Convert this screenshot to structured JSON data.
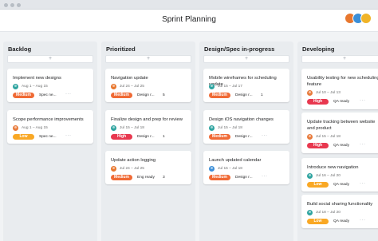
{
  "app": {
    "title": "Sprint Planning",
    "avatars": [
      "#e8772e",
      "#3c8fd8",
      "#f0b429"
    ]
  },
  "priority_colors": {
    "Medium": "#f06a35",
    "Low": "#f9a825",
    "High": "#e8384f"
  },
  "add_label": "+",
  "columns": [
    {
      "title": "Backlog",
      "cards": [
        {
          "title": "Implement new designs",
          "date": "Aug 1 – Aug 15",
          "priority": "Medium",
          "status": "Spec ne...",
          "count": "",
          "avatar": "#2fa4a0"
        },
        {
          "title": "Scope performance improvements",
          "date": "Aug 1 – Aug 15",
          "priority": "Low",
          "status": "Spec ne...",
          "count": "",
          "avatar": "#e87b3c"
        }
      ]
    },
    {
      "title": "Prioritized",
      "cards": [
        {
          "title": "Navigation update",
          "date": "Jul 24 – Jul 25",
          "priority": "Medium",
          "status": "Design r...",
          "count": "5",
          "avatar": "#e8772e"
        },
        {
          "title": "Finalize design and prep for review",
          "date": "Jul 15 – Jul 18",
          "priority": "High",
          "status": "Design r...",
          "count": "1",
          "avatar": "#2fa4a0"
        },
        {
          "title": "Update action logging",
          "date": "Jul 24 – Jul 25",
          "priority": "Medium",
          "status": "Eng ready",
          "count": "3",
          "avatar": "#e8772e"
        }
      ]
    },
    {
      "title": "Design/Spec in-progress",
      "cards": [
        {
          "title": "Mobile wireframes for scheduling update",
          "date": "Jul 15 – Jul 17",
          "priority": "Medium",
          "status": "Design r...",
          "count": "1",
          "avatar": "#2fa4a0"
        },
        {
          "title": "Design iOS navigation changes",
          "date": "Jul 15 – Jul 18",
          "priority": "Medium",
          "status": "Design r...",
          "count": "",
          "avatar": "#2fa4a0"
        },
        {
          "title": "Launch updated calendar",
          "date": "Jul 15 – Jul 18",
          "priority": "Medium",
          "status": "Design r...",
          "count": "",
          "avatar": "#3c8fd8"
        }
      ]
    },
    {
      "title": "Developing",
      "cards": [
        {
          "title": "Usability testing for new scheduling feature",
          "date": "Jul 10 – Jul 13",
          "priority": "High",
          "status": "QA ready",
          "count": "",
          "avatar": "#e87b3c"
        },
        {
          "title": "Update tracking between website and product",
          "date": "Jul 15 – Jul 18",
          "priority": "High",
          "status": "QA ready",
          "count": "",
          "avatar": "#e87b3c"
        },
        {
          "title": "Introduce new navigation",
          "date": "Jul 16 – Jul 20",
          "priority": "Low",
          "status": "QA ready",
          "count": "",
          "avatar": "#2fa4a0"
        },
        {
          "title": "Build social sharing functionality",
          "date": "Jul 18 – Jul 20",
          "priority": "Low",
          "status": "QA ready",
          "count": "",
          "avatar": "#2fa4a0"
        }
      ]
    }
  ]
}
